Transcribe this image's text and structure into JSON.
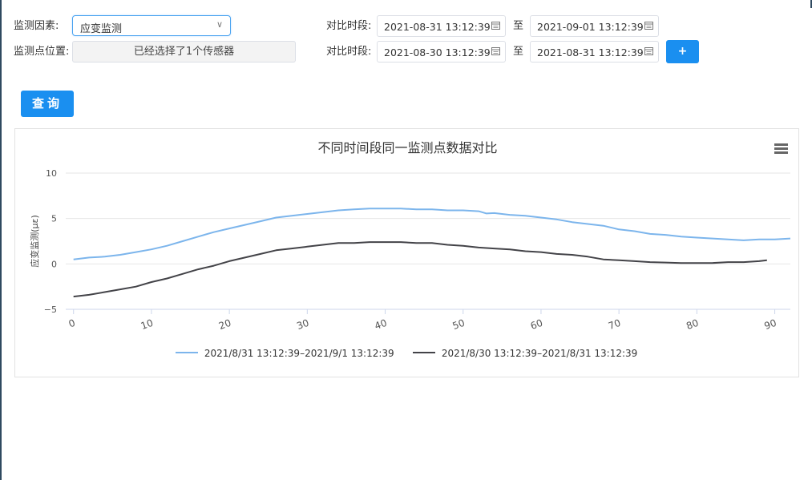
{
  "form": {
    "factor_label": "监测因素:",
    "factor_value": "应变监测",
    "location_label": "监测点位置:",
    "location_value": "已经选择了1个传感器",
    "period_label_1": "对比时段:",
    "period_label_2": "对比时段:",
    "to_1": "至",
    "to_2": "至",
    "period1_start": "2021-08-31 13:12:39",
    "period1_end": "2021-09-01 13:12:39",
    "period2_start": "2021-08-30 13:12:39",
    "period2_end": "2021-08-31 13:12:39",
    "add_label": "+",
    "query_label": "查询"
  },
  "colors": {
    "accent": "#1a8ff0",
    "series1": "#7cb5ec",
    "series2": "#434348"
  },
  "icons": [
    "chevron-down-icon",
    "calendar-icon",
    "menu-icon"
  ],
  "chart_data": {
    "type": "line",
    "title": "不同时间段同一监测点数据对比",
    "ylabel": "应变监测(με)",
    "xlabel": "",
    "ylim": [
      -5,
      10
    ],
    "xlim": [
      -1,
      92
    ],
    "yticks": [
      "10",
      "5",
      "0",
      "−5"
    ],
    "xticks": [
      "0",
      "10",
      "20",
      "30",
      "40",
      "50",
      "60",
      "70",
      "80",
      "90"
    ],
    "legend": "bottom-center",
    "grid": true,
    "series": [
      {
        "name": "2021/8/31 13:12:39–2021/9/1 13:12:39",
        "color": "#7cb5ec",
        "points": [
          [
            0,
            0.5
          ],
          [
            2,
            0.7
          ],
          [
            4,
            0.8
          ],
          [
            6,
            1.0
          ],
          [
            8,
            1.3
          ],
          [
            10,
            1.6
          ],
          [
            12,
            2.0
          ],
          [
            14,
            2.5
          ],
          [
            16,
            3.0
          ],
          [
            18,
            3.5
          ],
          [
            20,
            3.9
          ],
          [
            22,
            4.3
          ],
          [
            24,
            4.7
          ],
          [
            26,
            5.1
          ],
          [
            28,
            5.3
          ],
          [
            30,
            5.5
          ],
          [
            32,
            5.7
          ],
          [
            34,
            5.9
          ],
          [
            36,
            6.0
          ],
          [
            38,
            6.1
          ],
          [
            40,
            6.1
          ],
          [
            42,
            6.1
          ],
          [
            44,
            6.0
          ],
          [
            46,
            6.0
          ],
          [
            48,
            5.9
          ],
          [
            50,
            5.9
          ],
          [
            52,
            5.8
          ],
          [
            53,
            5.55
          ],
          [
            54,
            5.6
          ],
          [
            56,
            5.4
          ],
          [
            58,
            5.3
          ],
          [
            60,
            5.1
          ],
          [
            62,
            4.9
          ],
          [
            64,
            4.6
          ],
          [
            66,
            4.4
          ],
          [
            68,
            4.2
          ],
          [
            70,
            3.8
          ],
          [
            72,
            3.6
          ],
          [
            74,
            3.3
          ],
          [
            76,
            3.2
          ],
          [
            78,
            3.0
          ],
          [
            80,
            2.9
          ],
          [
            82,
            2.8
          ],
          [
            84,
            2.7
          ],
          [
            86,
            2.6
          ],
          [
            88,
            2.7
          ],
          [
            90,
            2.7
          ],
          [
            92,
            2.8
          ]
        ]
      },
      {
        "name": "2021/8/30 13:12:39–2021/8/31 13:12:39",
        "color": "#434348",
        "points": [
          [
            0,
            -3.6
          ],
          [
            2,
            -3.4
          ],
          [
            4,
            -3.1
          ],
          [
            6,
            -2.8
          ],
          [
            8,
            -2.5
          ],
          [
            10,
            -2.0
          ],
          [
            12,
            -1.6
          ],
          [
            14,
            -1.1
          ],
          [
            16,
            -0.6
          ],
          [
            18,
            -0.2
          ],
          [
            20,
            0.3
          ],
          [
            22,
            0.7
          ],
          [
            24,
            1.1
          ],
          [
            26,
            1.5
          ],
          [
            28,
            1.7
          ],
          [
            30,
            1.9
          ],
          [
            32,
            2.1
          ],
          [
            34,
            2.3
          ],
          [
            36,
            2.3
          ],
          [
            38,
            2.4
          ],
          [
            40,
            2.4
          ],
          [
            42,
            2.4
          ],
          [
            44,
            2.3
          ],
          [
            46,
            2.3
          ],
          [
            48,
            2.1
          ],
          [
            50,
            2.0
          ],
          [
            52,
            1.8
          ],
          [
            54,
            1.7
          ],
          [
            56,
            1.6
          ],
          [
            58,
            1.4
          ],
          [
            60,
            1.3
          ],
          [
            62,
            1.1
          ],
          [
            64,
            1.0
          ],
          [
            66,
            0.8
          ],
          [
            68,
            0.5
          ],
          [
            70,
            0.4
          ],
          [
            72,
            0.3
          ],
          [
            74,
            0.2
          ],
          [
            76,
            0.15
          ],
          [
            78,
            0.1
          ],
          [
            80,
            0.1
          ],
          [
            82,
            0.1
          ],
          [
            84,
            0.2
          ],
          [
            86,
            0.2
          ],
          [
            88,
            0.3
          ],
          [
            89,
            0.4
          ]
        ]
      }
    ]
  }
}
